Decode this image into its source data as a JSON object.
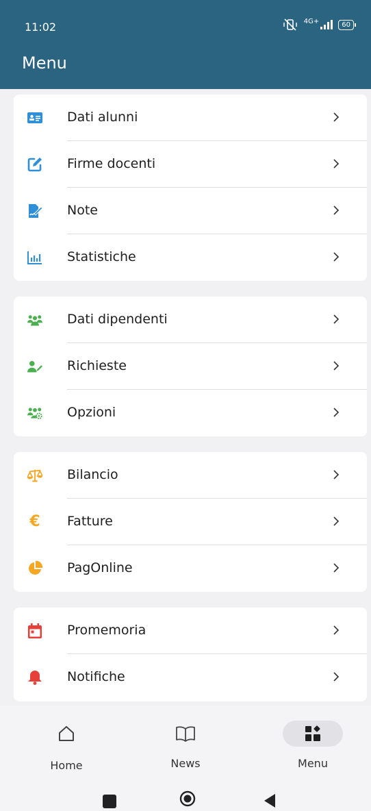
{
  "status": {
    "time": "11:02",
    "network": "4G+",
    "battery": "60"
  },
  "header": {
    "title": "Menu"
  },
  "groups": [
    {
      "items": [
        {
          "label": "Dati alunni",
          "icon": "id-card-icon"
        },
        {
          "label": "Firme docenti",
          "icon": "edit-square-icon"
        },
        {
          "label": "Note",
          "icon": "note-sign-icon"
        },
        {
          "label": "Statistiche",
          "icon": "bar-chart-icon"
        }
      ]
    },
    {
      "items": [
        {
          "label": "Dati dipendenti",
          "icon": "users-group-icon"
        },
        {
          "label": "Richieste",
          "icon": "user-pen-icon"
        },
        {
          "label": "Opzioni",
          "icon": "users-gear-icon"
        }
      ]
    },
    {
      "items": [
        {
          "label": "Bilancio",
          "icon": "scale-icon"
        },
        {
          "label": "Fatture",
          "icon": "euro-icon"
        },
        {
          "label": "PagOnline",
          "icon": "pie-chart-icon"
        }
      ]
    },
    {
      "items": [
        {
          "label": "Promemoria",
          "icon": "calendar-icon"
        },
        {
          "label": "Notifiche",
          "icon": "bell-icon"
        }
      ]
    }
  ],
  "bottom_nav": {
    "home": "Home",
    "news": "News",
    "menu": "Menu",
    "active": "menu"
  },
  "colors": {
    "header": "#2b6480",
    "blue": "#2f8fd8",
    "green": "#4caf50",
    "orange": "#f5a623",
    "red": "#e5403a"
  }
}
